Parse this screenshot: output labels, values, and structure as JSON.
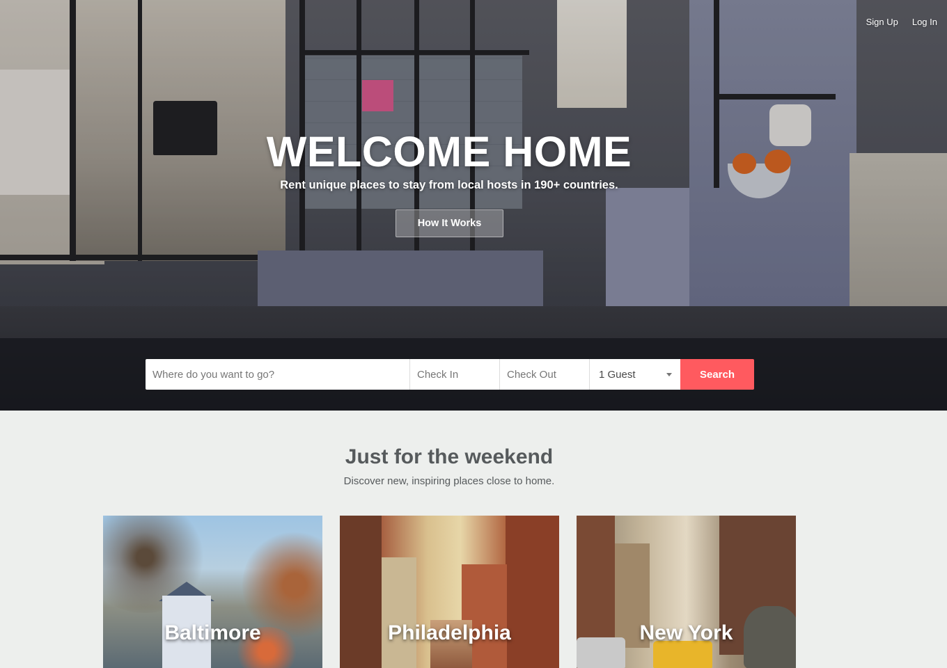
{
  "nav": {
    "signup": "Sign Up",
    "login": "Log In"
  },
  "hero": {
    "title": "WELCOME HOME",
    "subtitle": "Rent unique places to stay from local hosts in 190+ countries.",
    "how_it_works": "How It Works"
  },
  "search": {
    "where_placeholder": "Where do you want to go?",
    "checkin_placeholder": "Check In",
    "checkout_placeholder": "Check Out",
    "guests_value": "1 Guest",
    "button_label": "Search"
  },
  "section": {
    "title": "Just for the weekend",
    "subtitle": "Discover new, inspiring places close to home."
  },
  "cards": [
    {
      "label": "Baltimore"
    },
    {
      "label": "Philadelphia"
    },
    {
      "label": "New York"
    }
  ],
  "colors": {
    "accent": "#ff5a5f",
    "page_bg": "#edefed"
  }
}
